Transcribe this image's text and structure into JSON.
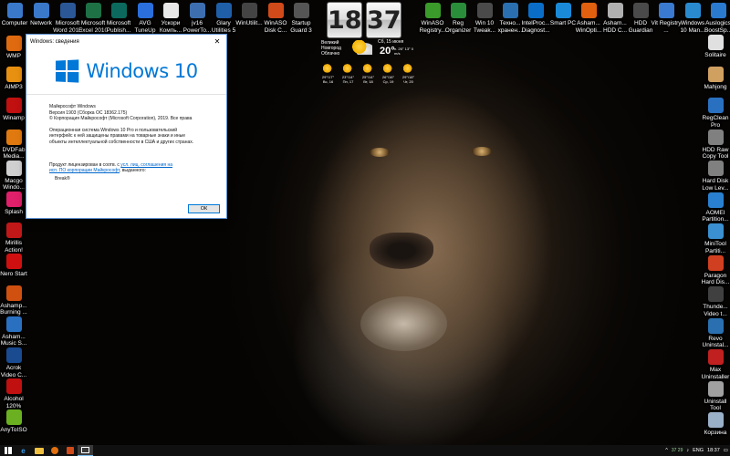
{
  "desktop": {
    "top_row": [
      {
        "label": "Computer",
        "icon": "computer-icon",
        "color": "#3a78c9"
      },
      {
        "label": "Network",
        "icon": "network-icon",
        "color": "#3a78c9"
      },
      {
        "label": "Microsoft Word 2010",
        "icon": "word-icon",
        "color": "#2b5797"
      },
      {
        "label": "Microsoft Excel 2010",
        "icon": "excel-icon",
        "color": "#1e7145"
      },
      {
        "label": "Microsoft Publish...",
        "icon": "publisher-icon",
        "color": "#0b6a5d"
      },
      {
        "label": "AVG TuneUp",
        "icon": "avg-tuneup-icon",
        "color": "#2a6fdb"
      },
      {
        "label": "Ускори Компь...",
        "icon": "speedup-icon",
        "color": "#e8e8e8"
      },
      {
        "label": "jv16 PowerTo...",
        "icon": "jv16-icon",
        "color": "#3d6fb0"
      },
      {
        "label": "Glary Utilities 5",
        "icon": "glary-icon",
        "color": "#1f5fa8"
      },
      {
        "label": "WinUtilit...",
        "icon": "winutilities-icon",
        "color": "#444444"
      },
      {
        "label": "WinASO Disk C...",
        "icon": "winaso-disk-icon",
        "color": "#d04a1a"
      },
      {
        "label": "Startup Guard 3",
        "icon": "startup-guard-icon",
        "color": "#555555"
      },
      {
        "label": "WinASO Registry...",
        "icon": "winaso-registry-icon",
        "color": "#3a9a2a"
      },
      {
        "label": "Reg Organizer",
        "icon": "reg-organizer-icon",
        "color": "#2a8d3a"
      },
      {
        "label": "Win 10 Tweak...",
        "icon": "win10-tweaker-icon",
        "color": "#4a4a4a"
      },
      {
        "label": "Техно... хранен...",
        "icon": "storage-tech-icon",
        "color": "#2a6fb0"
      },
      {
        "label": "IntelProc... Diagnost...",
        "icon": "intel-diag-icon",
        "color": "#0a6ec8"
      },
      {
        "label": "Smart PC",
        "icon": "smart-pc-icon",
        "color": "#1a8ad8"
      },
      {
        "label": "Asham... WinOpti...",
        "icon": "ashampoo-winoptimizer-icon",
        "color": "#e06010"
      },
      {
        "label": "Asham... HDD C...",
        "icon": "ashampoo-hdd-icon",
        "color": "#b0b0b0"
      },
      {
        "label": "HDD Guardian",
        "icon": "hdd-guardian-icon",
        "color": "#4a4a4a"
      },
      {
        "label": "Vit Registry ...",
        "icon": "vit-registry-icon",
        "color": "#3a7ad0"
      },
      {
        "label": "Windows 10 Man...",
        "icon": "windows10-manager-icon",
        "color": "#2a8ad0"
      },
      {
        "label": "Auslogics BoostSp...",
        "icon": "auslogics-icon",
        "color": "#2a7ad0"
      }
    ],
    "left_col": [
      {
        "label": "WMP",
        "icon": "wmp-icon",
        "color": "#e06a10"
      },
      {
        "label": "AIMP3",
        "icon": "aimp-icon",
        "color": "#e89010"
      },
      {
        "label": "Winamp",
        "icon": "winamp-icon",
        "color": "#c01010"
      },
      {
        "label": "DVDFab Media...",
        "icon": "dvdfab-icon",
        "color": "#e07a10"
      },
      {
        "label": "Macgo Windo...",
        "icon": "macgo-icon",
        "color": "#d0d0d0"
      },
      {
        "label": "Splash",
        "icon": "splash-icon",
        "color": "#e0206a"
      },
      {
        "label": "Mirillis Action!",
        "icon": "mirillis-icon",
        "color": "#c01818"
      },
      {
        "label": "Nero Start",
        "icon": "nero-icon",
        "color": "#d01010"
      },
      {
        "label": "Ashamp... Burning ...",
        "icon": "ashampoo-burning-icon",
        "color": "#d05010"
      },
      {
        "label": "Asham... Music S...",
        "icon": "ashampoo-music-icon",
        "color": "#2a70c0"
      },
      {
        "label": "Acrok Video C...",
        "icon": "acrok-icon",
        "color": "#1a4a90"
      },
      {
        "label": "Alcohol 120%",
        "icon": "alcohol-icon",
        "color": "#c01010"
      },
      {
        "label": "AnyToISO",
        "icon": "anytoiso-icon",
        "color": "#6ab020"
      }
    ],
    "right_col": [
      {
        "label": "Solitaire",
        "icon": "solitaire-icon",
        "color": "#e0e0e0"
      },
      {
        "label": "Mahjong",
        "icon": "mahjong-icon",
        "color": "#d0a060"
      },
      {
        "label": "RegClean Pro",
        "icon": "regclean-icon",
        "color": "#2a70c0"
      },
      {
        "label": "HDD Raw Copy Tool",
        "icon": "hdd-raw-copy-icon",
        "color": "#808080"
      },
      {
        "label": "Hard Disk Low Lev...",
        "icon": "hdd-lowlevel-icon",
        "color": "#808080"
      },
      {
        "label": "AOMEI Partition...",
        "icon": "aomei-icon",
        "color": "#2a80d0"
      },
      {
        "label": "MiniTool Partiti...",
        "icon": "minitool-icon",
        "color": "#3a90d0"
      },
      {
        "label": "Paragon Hard Dis...",
        "icon": "paragon-icon",
        "color": "#d04020"
      },
      {
        "label": "Thunde... Video t...",
        "icon": "thunder-video-icon",
        "color": "#404040"
      },
      {
        "label": "Revo Uninstal...",
        "icon": "revo-icon",
        "color": "#2a70b0"
      },
      {
        "label": "Max Uninstaller",
        "icon": "max-uninstaller-icon",
        "color": "#c02020"
      },
      {
        "label": "Uninstall Tool",
        "icon": "uninstall-tool-icon",
        "color": "#a0a0a0"
      },
      {
        "label": "Корзина",
        "icon": "recycle-bin-icon",
        "color": "#9ab0c8"
      }
    ]
  },
  "clock_widget": {
    "hours": "18",
    "minutes": "37"
  },
  "weather": {
    "city": "Великий Новгород Облачно",
    "date": "Сб, 15 июня",
    "temp": "20°",
    "extra": "н. 26° 13° 0 m/s",
    "forecast": [
      {
        "text": "29°/17° Вс, 16"
      },
      {
        "text": "23°/14° Пн, 17"
      },
      {
        "text": "25°/14° Вт, 18"
      },
      {
        "text": "26°/16° Ср, 19"
      },
      {
        "text": "29°/18° Чт, 20"
      }
    ]
  },
  "about_dialog": {
    "title": "Windows: сведения",
    "close_glyph": "✕",
    "wordmark": "Windows 10",
    "product": "Майкрософт Windows",
    "version": "Версия 1903 (Сборка ОС 18362.175)",
    "copyright": "© Корпорация Майкрософт (Microsoft Corporation), 2019. Все права",
    "legal_1": "Операционная система Windows 10 Pro и пользовательский",
    "legal_2": "интерфейс к ней защищены правами на товарные знаки и иные",
    "legal_3": "объекты интеллектуальной собственности в США и других странах.",
    "license_prefix": "Продукт лицензирован в соотв. с",
    "license_link_1": "усл. лиц. соглашения на",
    "license_link_2": "исп. ПО корпорации Майкрософт",
    "license_suffix": ", выданного:",
    "owner": "Break®",
    "ok_label": "ОК"
  },
  "taskbar": {
    "tray_lang": "ENG",
    "tray_time": "18:37",
    "tray_nums": "37 29"
  }
}
